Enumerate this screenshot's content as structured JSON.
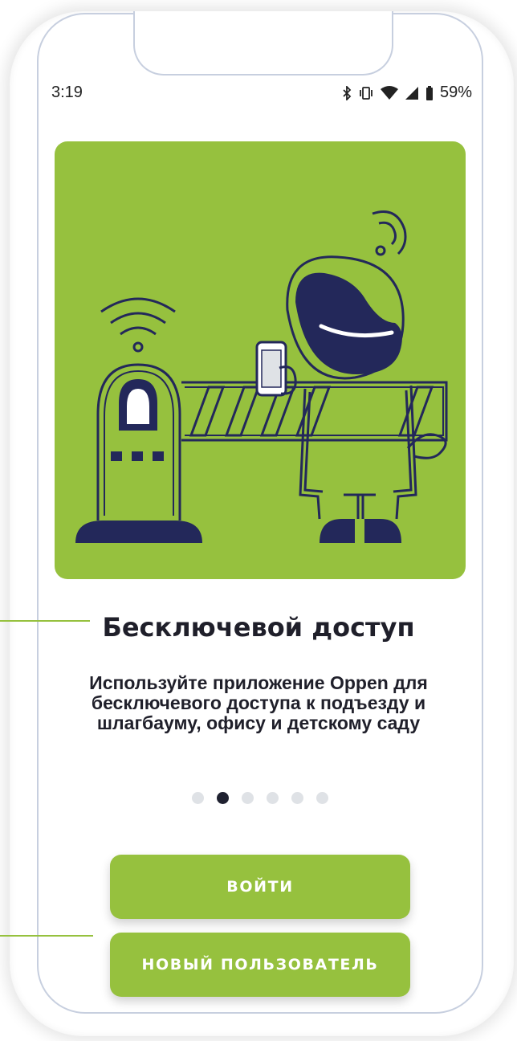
{
  "status_bar": {
    "time": "3:19",
    "battery_percent": "59%",
    "icons": [
      "bluetooth-icon",
      "vibrate-icon",
      "wifi-icon",
      "signal-icon",
      "battery-icon"
    ]
  },
  "slide": {
    "title": "Бесключевой доступ",
    "description": "Используйте приложение Oppen для бесключевого доступа к подъезду и шлагбауму, офису и детскому саду",
    "illustration": "barrier-phone-access-illustration"
  },
  "pagination": {
    "total": 6,
    "active_index": 1
  },
  "buttons": {
    "login_label": "ВОЙТИ",
    "new_user_label": "НОВЫЙ ПОЛЬЗОВАТЕЛЬ"
  },
  "colors": {
    "accent": "#96c13e",
    "dark": "#1f2130",
    "dot_inactive": "#dfe2e6"
  }
}
